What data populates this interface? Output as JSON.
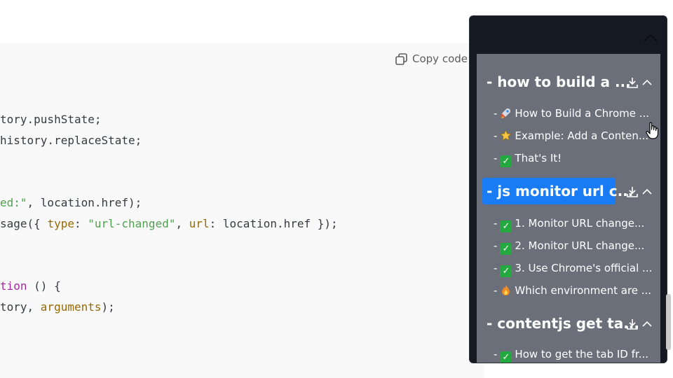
{
  "code": {
    "copy_label": "Copy code",
    "lines": [
      {
        "t1": "tory.pushState;"
      },
      {
        "t1": "history.replaceState;"
      },
      {
        "s": "ed:\"",
        "t1": ", location.href);"
      },
      {
        "t0": "sage({ ",
        "k1": "type",
        "t1": ": ",
        "s": "\"url-changed\"",
        "t2": ", ",
        "k2": "url",
        "t3": ": location.href });"
      },
      {
        "kw": "tion",
        "t1": " () {"
      },
      {
        "t0": "tory, ",
        "p": "arguments",
        "t1": ");"
      }
    ]
  },
  "sidebar": {
    "groups": [
      {
        "title": "- how to build a ...",
        "items": [
          {
            "prefix": "-",
            "icon": "rocket-icon",
            "label": "How to Build a Chrome ..."
          },
          {
            "prefix": "-",
            "icon": "star-icon",
            "label": "Example: Add a Conten..."
          },
          {
            "prefix": "-",
            "icon": "check-icon",
            "label": "That's It!"
          }
        ]
      },
      {
        "title": "- js monitor url c...",
        "items": [
          {
            "prefix": "-",
            "icon": "check-icon",
            "label": "1. Monitor URL change..."
          },
          {
            "prefix": "-",
            "icon": "check-icon",
            "label": "2. Monitor URL change..."
          },
          {
            "prefix": "-",
            "icon": "check-icon",
            "label": "3. Use Chrome's official ..."
          },
          {
            "prefix": "-",
            "icon": "fire-icon",
            "label": "Which environment are ..."
          }
        ]
      },
      {
        "title": "- contentjs get ta...",
        "items": [
          {
            "prefix": "-",
            "icon": "check-icon",
            "label": "How to get the tab ID fr..."
          }
        ]
      }
    ]
  },
  "colors": {
    "active_group": "#1a7cf5",
    "list_bg": "#6b6f7a",
    "panel_bg": "#151922"
  }
}
